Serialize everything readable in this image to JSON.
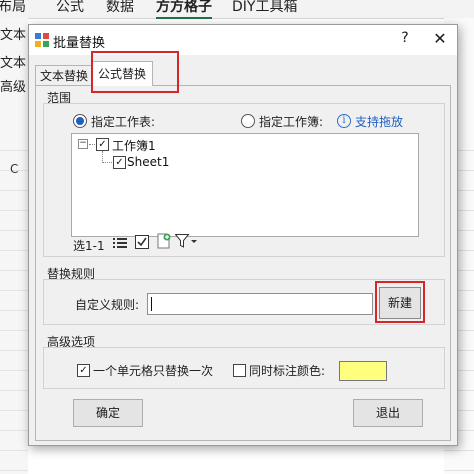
{
  "excel": {
    "ribbon_tabs": [
      "布局",
      "公式",
      "数据",
      "方方格子",
      "DIY工具箱"
    ],
    "left_labels": [
      "文本",
      "文本",
      "高级"
    ],
    "col_header": "C"
  },
  "dialog": {
    "title": "批量替换",
    "help_label": "?",
    "close_label": "✕",
    "tabs": {
      "text": "文本替换",
      "formula": "公式替换"
    },
    "scope": {
      "label": "范围",
      "radio_sheet": "指定工作表:",
      "radio_workbook": "指定工作簿:",
      "info_icon": "i",
      "drag_support": "支持拖放",
      "tree": {
        "workbook": "工作簿1",
        "sheet": "Sheet1"
      },
      "select_count": "选1-1"
    },
    "rules": {
      "label": "替换规则",
      "custom_rule_label": "自定义规则:",
      "custom_rule_value": "",
      "new_button": "新建"
    },
    "advanced": {
      "label": "高级选项",
      "once_per_cell": "一个单元格只替换一次",
      "mark_color": "同时标注颜色:",
      "swatch_color": "#ffff7f"
    },
    "ok_button": "确定",
    "exit_button": "退出"
  },
  "colors": {
    "highlight": "#d42828",
    "radio_fill": "#1e5fbf"
  }
}
